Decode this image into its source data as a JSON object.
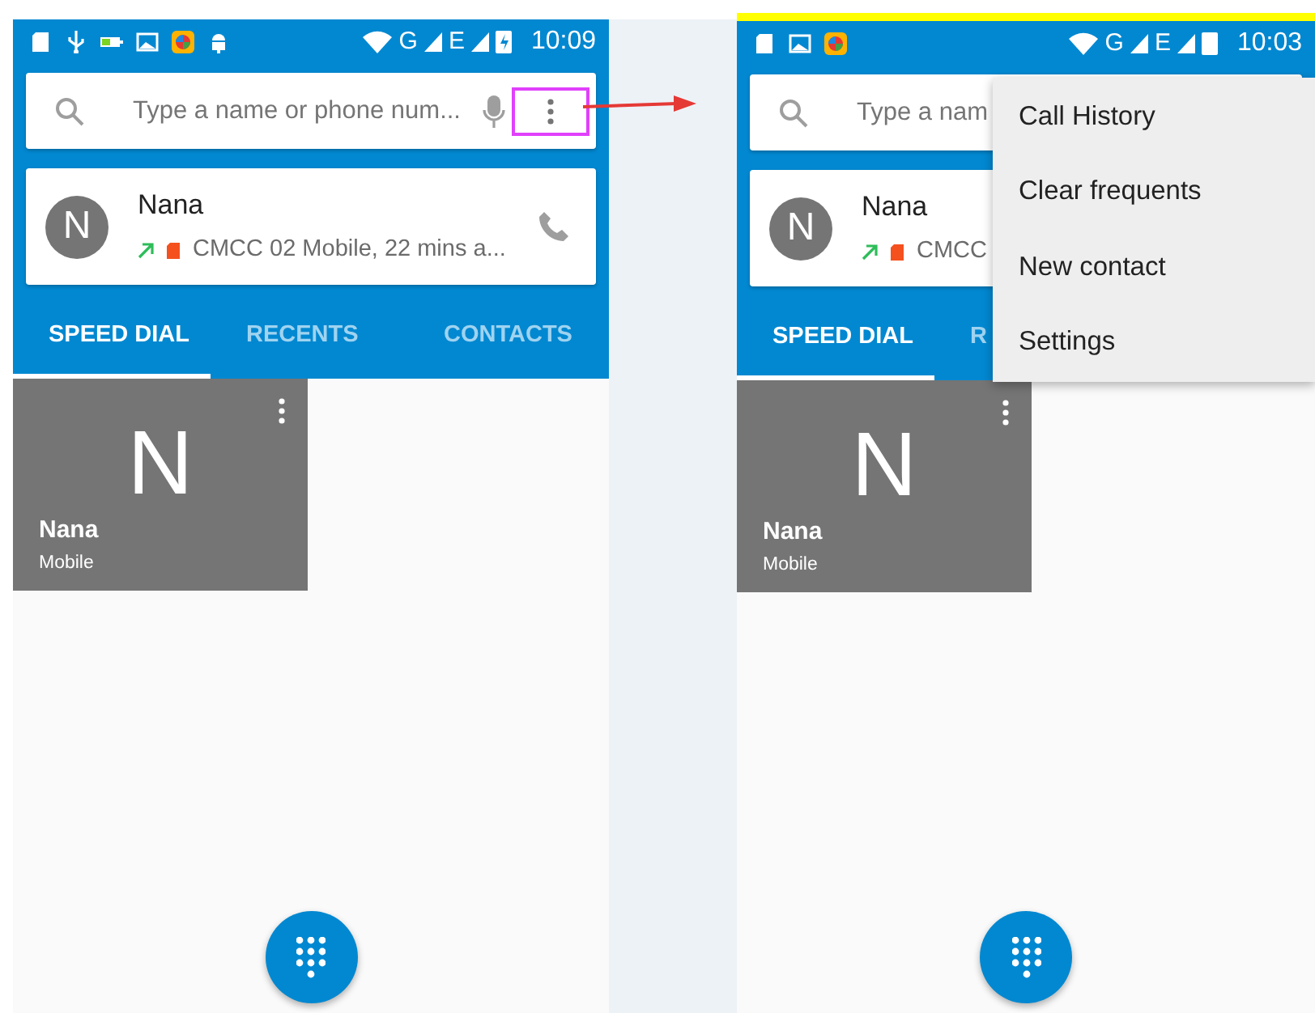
{
  "phones": [
    {
      "status_bar": {
        "notification_icons": [
          {
            "kind": "sd"
          },
          {
            "kind": "usb"
          },
          {
            "kind": "battery_saver"
          },
          {
            "kind": "image"
          },
          {
            "kind": "app"
          },
          {
            "kind": "android"
          }
        ],
        "network_labels": [
          "G",
          "E"
        ],
        "battery": {
          "kind": "charging"
        },
        "time": "10:09"
      },
      "search": {
        "placeholder": "Type a name or phone num...",
        "actions": [
          {
            "kind": "mic"
          },
          {
            "kind": "more",
            "highlighted": true
          }
        ]
      },
      "recent": {
        "initial": "N",
        "name": "Nana",
        "detail": "CMCC 02 Mobile, 22 mins a...",
        "actions": [
          {
            "kind": "call"
          }
        ]
      },
      "tabs": [
        {
          "label": "SPEED DIAL",
          "selected": true
        },
        {
          "label": "RECENTS",
          "selected": false
        },
        {
          "label": "CONTACTS",
          "selected": false
        }
      ],
      "tiles": [
        {
          "initial": "N",
          "name": "Nana",
          "type": "Mobile"
        }
      ]
    },
    {
      "top_strip": true,
      "status_bar": {
        "notification_icons": [
          {
            "kind": "sd"
          },
          {
            "kind": "image"
          },
          {
            "kind": "app"
          }
        ],
        "network_labels": [
          "G",
          "E"
        ],
        "battery": {
          "kind": "plain"
        },
        "time": "10:03"
      },
      "search": {
        "placeholder": "Type a nam"
      },
      "recent": {
        "initial": "N",
        "name": "Nana",
        "detail": "CMCC"
      },
      "tabs": [
        {
          "label": "SPEED DIAL",
          "selected": true
        },
        {
          "label": "R",
          "selected": false
        }
      ],
      "tiles": [
        {
          "initial": "N",
          "name": "Nana",
          "type": "Mobile"
        }
      ],
      "menu": [
        "Call History",
        "Clear frequents",
        "New contact",
        "Settings"
      ]
    }
  ],
  "annotation_arrow": true
}
